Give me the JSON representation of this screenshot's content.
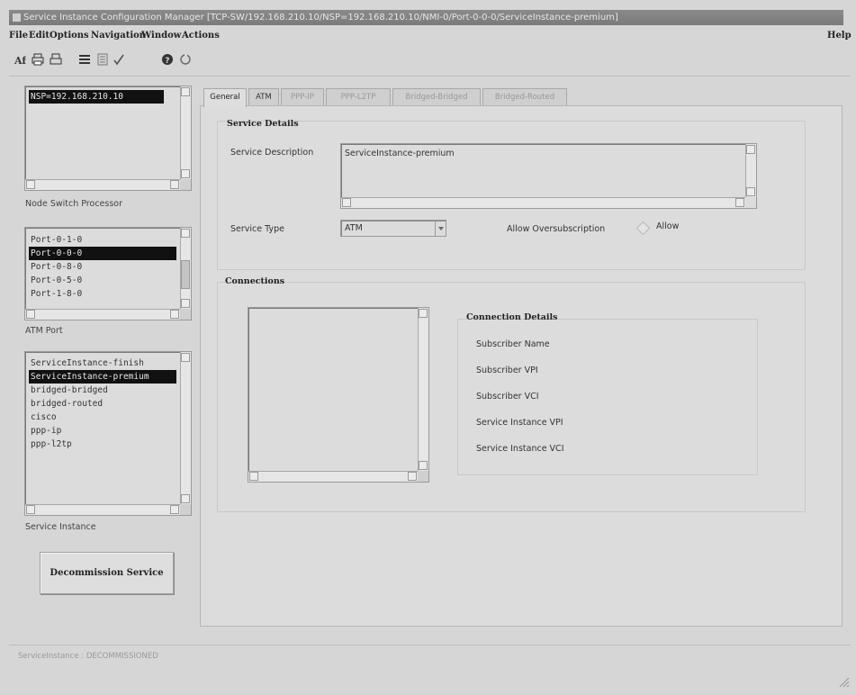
{
  "window": {
    "title": "Service Instance Configuration Manager [TCP-SW/192.168.210.10/NSP=192.168.210.10/NMI-0/Port-0-0-0/ServiceInstance-premium]"
  },
  "menu": [
    "File",
    "Edit",
    "Options",
    "Navigation",
    "Window",
    "Actions"
  ],
  "help_label": "Help",
  "toolbar_icons": [
    "text-icon",
    "print-icon",
    "print-preview-icon",
    "list-icon",
    "document-icon",
    "checkmark-icon",
    "help-icon",
    "refresh-icon"
  ],
  "nsp_list": {
    "items": [
      "NSP=192.168.210.10"
    ],
    "selected_index": 0,
    "label": "Node Switch Processor"
  },
  "atm_port_list": {
    "items": [
      "Port-0-1-0",
      "Port-0-0-0",
      "Port-0-8-0",
      "Port-0-5-0",
      "Port-1-8-0"
    ],
    "selected_index": 1,
    "label": "ATM Port"
  },
  "service_instance_list": {
    "items": [
      "ServiceInstance-finish",
      "ServiceInstance-premium",
      "bridged-bridged",
      "bridged-routed",
      "cisco",
      "ppp-ip",
      "ppp-l2tp"
    ],
    "selected_index": 1,
    "label": "Service Instance"
  },
  "decommission_button": "Decommission Service",
  "tabs": [
    {
      "label": "General",
      "state": "active"
    },
    {
      "label": "ATM",
      "state": "enabled"
    },
    {
      "label": "PPP-IP",
      "state": "disabled"
    },
    {
      "label": "PPP-L2TP",
      "state": "disabled"
    },
    {
      "label": "Bridged-Bridged",
      "state": "disabled"
    },
    {
      "label": "Bridged-Routed",
      "state": "disabled"
    }
  ],
  "service_details": {
    "title": "Service Details",
    "description_label": "Service Description",
    "description_value": "ServiceInstance-premium",
    "type_label": "Service Type",
    "type_value": "ATM",
    "oversub_label": "Allow Oversubscription",
    "oversub_option": "Allow"
  },
  "connections": {
    "title": "Connections",
    "details_title": "Connection Details",
    "fields": [
      "Subscriber Name",
      "Subscriber VPI",
      "Subscriber VCI",
      "Service Instance VPI",
      "Service Instance VCI"
    ]
  },
  "status": "ServiceInstance : DECOMMISSIONED"
}
